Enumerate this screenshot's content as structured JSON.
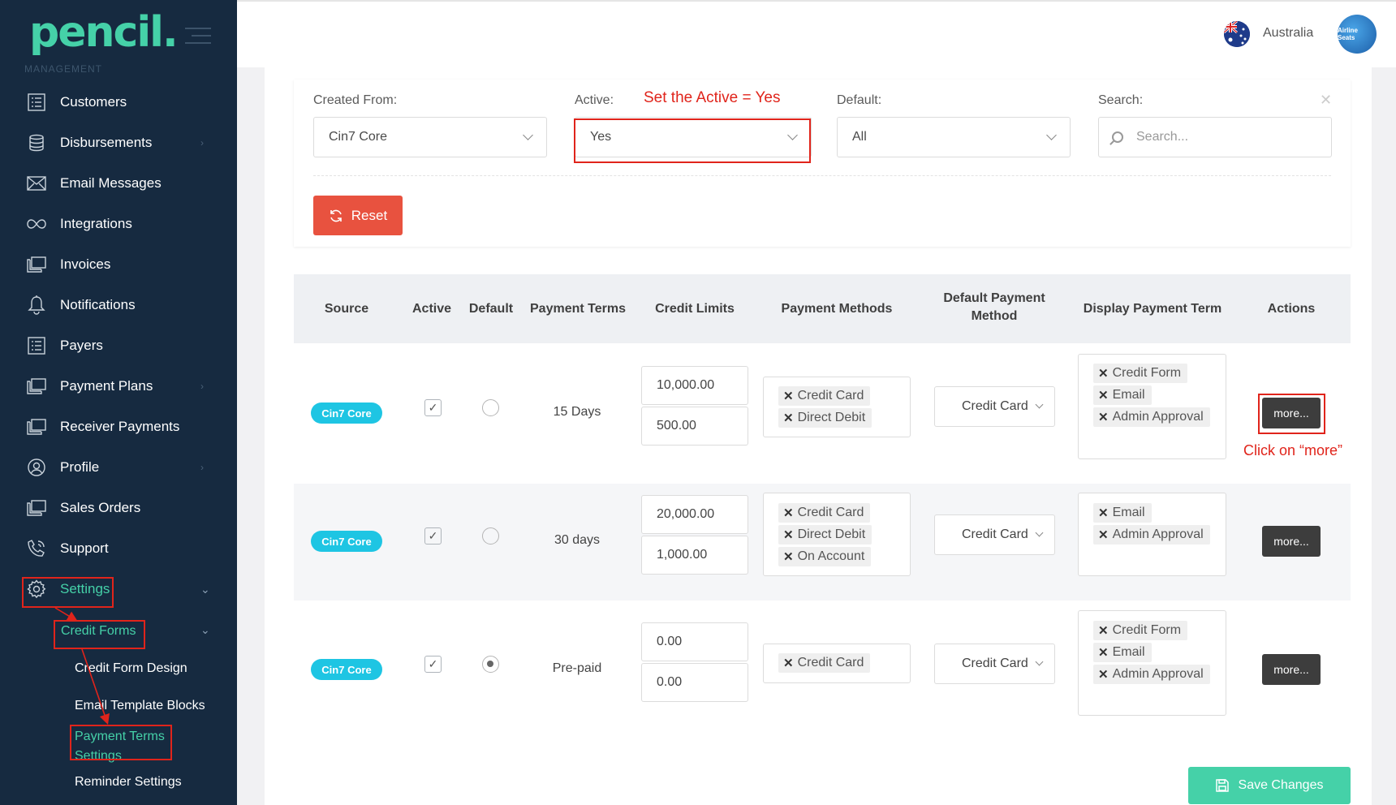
{
  "sidebar": {
    "logo": "pencil.",
    "section": "MANAGEMENT",
    "items": [
      {
        "label": "Customers",
        "icon": "list-icon"
      },
      {
        "label": "Disbursements",
        "icon": "coins-icon"
      },
      {
        "label": "Email Messages",
        "icon": "envelope-icon"
      },
      {
        "label": "Integrations",
        "icon": "infinity-icon"
      },
      {
        "label": "Invoices",
        "icon": "documents-icon"
      },
      {
        "label": "Notifications",
        "icon": "bell-icon"
      },
      {
        "label": "Payers",
        "icon": "list-icon"
      },
      {
        "label": "Payment Plans",
        "icon": "documents-icon"
      },
      {
        "label": "Receiver Payments",
        "icon": "documents-icon"
      },
      {
        "label": "Profile",
        "icon": "globe-user-icon"
      },
      {
        "label": "Sales Orders",
        "icon": "documents-icon"
      },
      {
        "label": "Support",
        "icon": "phone-icon"
      },
      {
        "label": "Settings",
        "icon": "gear-icon"
      }
    ],
    "submenu": {
      "label": "Credit Forms",
      "items": [
        "Credit Form Design",
        "Email Template Blocks",
        "Payment Terms Settings",
        "Reminder Settings"
      ]
    }
  },
  "header": {
    "country": "Australia",
    "avatar_text": "Airline Seats"
  },
  "filters": {
    "created_from_label": "Created From:",
    "created_from_value": "Cin7 Core",
    "active_label": "Active:",
    "active_value": "Yes",
    "default_label": "Default:",
    "default_value": "All",
    "search_label": "Search:",
    "search_placeholder": "Search...",
    "reset_label": "Reset"
  },
  "annotations": {
    "active_hint": "Set the Active = Yes",
    "more_hint": "Click on “more”"
  },
  "table": {
    "headers": [
      "Source",
      "Active",
      "Default",
      "Payment Terms",
      "Credit Limits",
      "Payment Methods",
      "Default Payment Method",
      "Display Payment Term",
      "Actions"
    ],
    "rows": [
      {
        "source": "Cin7 Core",
        "active": true,
        "default": false,
        "terms": "15 Days",
        "limit1": "10,000.00",
        "limit2": "500.00",
        "methods": [
          "Credit Card",
          "Direct Debit"
        ],
        "default_method": "Credit Card",
        "display": [
          "Credit Form",
          "Email",
          "Admin Approval"
        ],
        "action": "more..."
      },
      {
        "source": "Cin7 Core",
        "active": true,
        "default": false,
        "terms": "30 days",
        "limit1": "20,000.00",
        "limit2": "1,000.00",
        "methods": [
          "Credit Card",
          "Direct Debit",
          "On Account"
        ],
        "default_method": "Credit Card",
        "display": [
          "Email",
          "Admin Approval"
        ],
        "action": "more..."
      },
      {
        "source": "Cin7 Core",
        "active": true,
        "default": true,
        "terms": "Pre-paid",
        "limit1": "0.00",
        "limit2": "0.00",
        "methods": [
          "Credit Card"
        ],
        "default_method": "Credit Card",
        "display": [
          "Credit Form",
          "Email",
          "Admin Approval"
        ],
        "action": "more..."
      }
    ]
  },
  "save_label": "Save Changes",
  "colors": {
    "accent": "#45d1a8",
    "sidebar": "#162a40",
    "danger": "#e8523f",
    "badge": "#1ec5e3",
    "annotation": "#e0241b"
  }
}
